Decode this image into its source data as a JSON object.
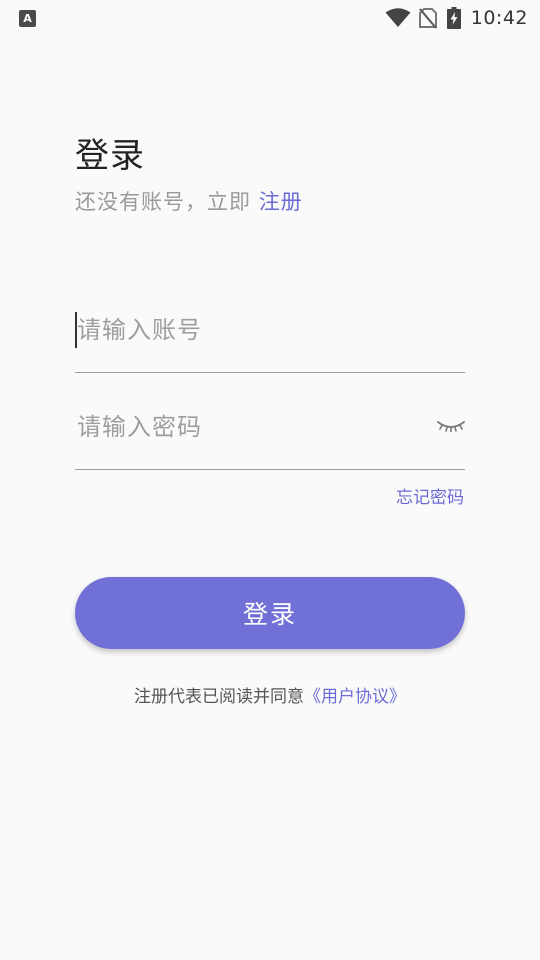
{
  "status_bar": {
    "app_icon_letter": "A",
    "time": "10:42",
    "icons": [
      "wifi-icon",
      "no-sim-icon",
      "battery-charging-icon"
    ]
  },
  "header": {
    "title": "登录",
    "subtitle_prefix": "还没有账号，立即 ",
    "register_link": "注册"
  },
  "form": {
    "account_placeholder": "请输入账号",
    "account_value": "",
    "password_placeholder": "请输入密码",
    "password_value": "",
    "password_toggle_icon": "eye-closed-icon",
    "forgot_password": "忘记密码",
    "login_button": "登录"
  },
  "agreement": {
    "prefix": "注册代表已阅读并同意",
    "link": "《用户协议》"
  },
  "colors": {
    "accent": "#6b6bd6",
    "button": "#7170d6",
    "background": "#fafafa"
  }
}
